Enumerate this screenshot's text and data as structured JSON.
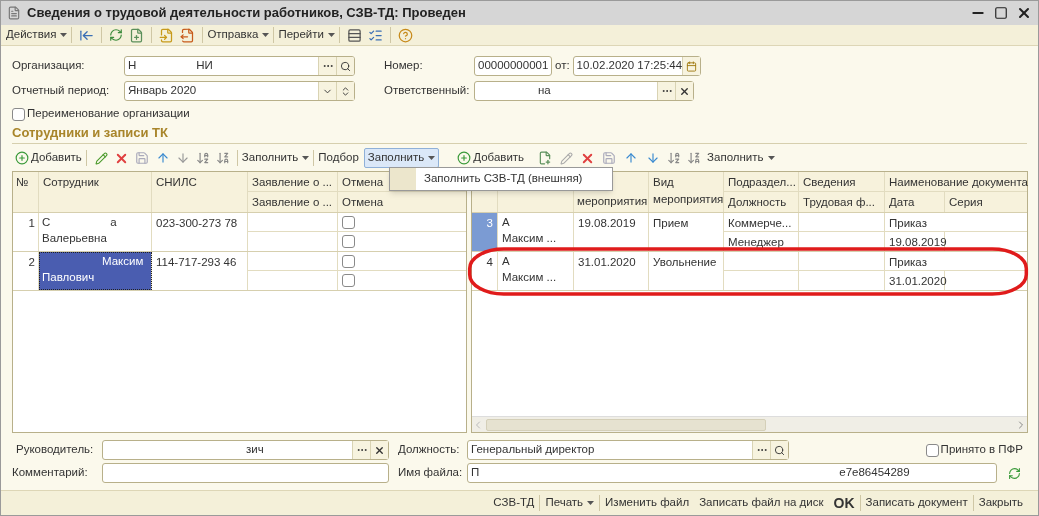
{
  "window": {
    "title": "Сведения о трудовой деятельности работников, СЗВ-ТД: Проведен"
  },
  "toolbar": [
    "Действия",
    "Отправка",
    "Перейти"
  ],
  "organization": {
    "label": "Организация:",
    "value": [
      {
        "kind": "text",
        "text": "Н"
      },
      {
        "kind": "redacted"
      },
      {
        "kind": "text",
        "text": "НИ"
      }
    ]
  },
  "number": {
    "label": "Номер:",
    "value": "00000000001"
  },
  "date": {
    "label": "от:",
    "value": "10.02.2020 17:25:44"
  },
  "period": {
    "label": "Отчетный период:",
    "value": "Январь 2020"
  },
  "responsible": {
    "label": "Ответственный:",
    "value": [
      {
        "kind": "redacted"
      },
      {
        "kind": "text",
        "text": "на"
      }
    ]
  },
  "rename": {
    "label": "Переименование организации",
    "checked": false
  },
  "section_title": "Сотрудники и записи ТК",
  "left_toolbar": {
    "add": "Добавить",
    "fill": "Заполнить",
    "pick": "Подбор",
    "fill_open": "Заполнить",
    "open": true
  },
  "right_toolbar": {
    "add": "Добавить",
    "fill": "Заполнить"
  },
  "fill_menu": [
    "Заполнить СЗВ-ТД (внешняя)"
  ],
  "left_table": {
    "columns": [
      "№",
      "Сотрудник",
      "СНИЛС",
      "Заявление о ...",
      "Отмена"
    ],
    "subcolumns": [
      "Заявление о ...",
      "Отмена"
    ],
    "rows": [
      {
        "num": "1",
        "employee": [
          {
            "kind": "text",
            "text": "С"
          },
          {
            "kind": "redacted"
          },
          {
            "kind": "text",
            "text": "а"
          }
        ],
        "employee_line2": "Валерьевна",
        "snils": "023-300-273 78",
        "cancel": [
          false,
          false
        ],
        "selected": false
      },
      {
        "num": "2",
        "employee": [
          {
            "kind": "redacted"
          },
          {
            "kind": "text",
            "text": "Максим"
          }
        ],
        "employee_line2": "Павлович",
        "snils": "114-717-293 46",
        "cancel": [
          false,
          false
        ],
        "selected": true
      }
    ]
  },
  "right_table": {
    "date_header": "мероприятия",
    "event_header": "Вид мероприятия",
    "dept_header": "Подраздел...",
    "position_header": "Должность",
    "info_header": "Сведения",
    "labor_header": "Трудовая ф...",
    "doc_header": "Наименование документа",
    "doc_date_header": "Дата",
    "series_header": "Серия",
    "rows": [
      {
        "num": "3",
        "employee": "А",
        "employee_line2": "Максим ...",
        "date": "19.08.2019",
        "event": "Прием",
        "dept": "Коммерче...",
        "position": "Менеджер",
        "doc": "Приказ",
        "doc_date": "19.08.2019",
        "selected": true
      },
      {
        "num": "4",
        "employee": "А",
        "employee_line2": "Максим ...",
        "date": "31.01.2020",
        "event": "Увольнение",
        "doc": "Приказ",
        "doc_date": "31.01.2020",
        "selected": false
      }
    ]
  },
  "annotation": {
    "kind": "ellipse",
    "color": "#e01b1b"
  },
  "head": {
    "label": "Руководитель:",
    "value": [
      {
        "kind": "redacted"
      },
      {
        "kind": "text",
        "text": "зич"
      }
    ]
  },
  "position": {
    "label": "Должность:",
    "value": "Генеральный директор"
  },
  "accepted": {
    "label": "Принято в ПФР",
    "checked": false
  },
  "comment": {
    "label": "Комментарий:"
  },
  "file_name": {
    "label": "Имя файла:",
    "value": [
      {
        "kind": "text",
        "text": "П"
      },
      {
        "kind": "redacted"
      },
      {
        "kind": "text",
        "text": "e7e86454289"
      }
    ]
  },
  "footer": [
    {
      "label": "СЗВ-ТД",
      "kind": "button",
      "divider_after": true
    },
    {
      "label": "Печать",
      "kind": "menu",
      "divider_after": true
    },
    {
      "label": "Изменить файл",
      "kind": "button",
      "divider_after": false
    },
    {
      "label": "Записать файл на диск",
      "kind": "button",
      "divider_after": false
    },
    {
      "label": "OK",
      "kind": "default",
      "divider_after": true
    },
    {
      "label": "Записать документ",
      "kind": "button",
      "divider_after": true
    },
    {
      "label": "Закрыть",
      "kind": "button",
      "divider_after": false
    }
  ]
}
